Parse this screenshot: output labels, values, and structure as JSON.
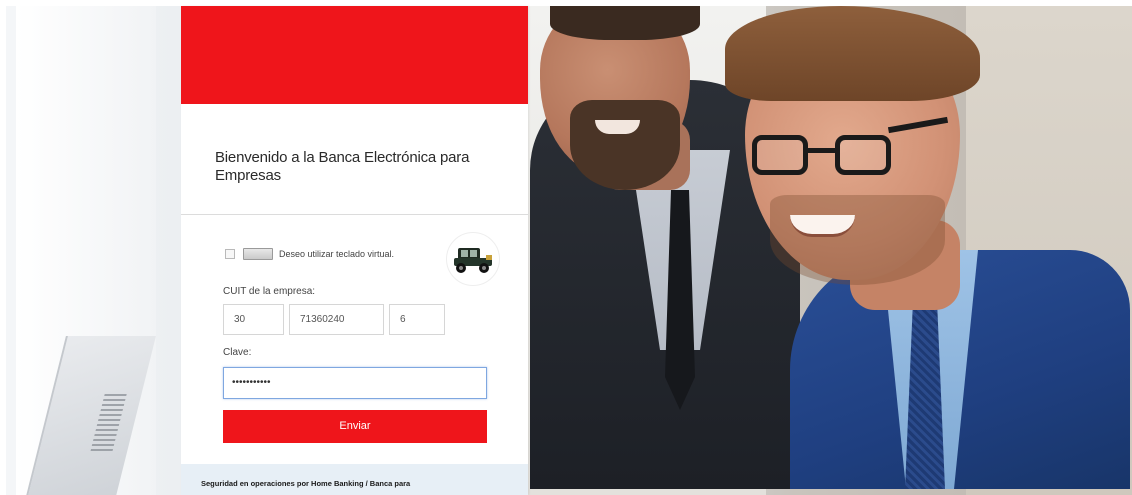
{
  "panel": {
    "welcome_title": "Bienvenido a la Banca Electrónica para Empresas",
    "virtual_keyboard_label": "Deseo utilizar teclado virtual.",
    "cuit_label": "CUIT de la empresa:",
    "cuit_part1": "30",
    "cuit_part2": "71360240",
    "cuit_part3": "6",
    "password_label": "Clave:",
    "password_value": "•••••••••••",
    "submit_label": "Enviar",
    "security_text": "Seguridad en operaciones por Home Banking / Banca para"
  },
  "colors": {
    "brand_red": "#ef151b",
    "input_focus_border": "#7fa7e0",
    "security_bg": "#e7eff6"
  },
  "icons": {
    "virtual_keyboard": "keyboard-icon",
    "badge": "vintage-car-icon"
  }
}
